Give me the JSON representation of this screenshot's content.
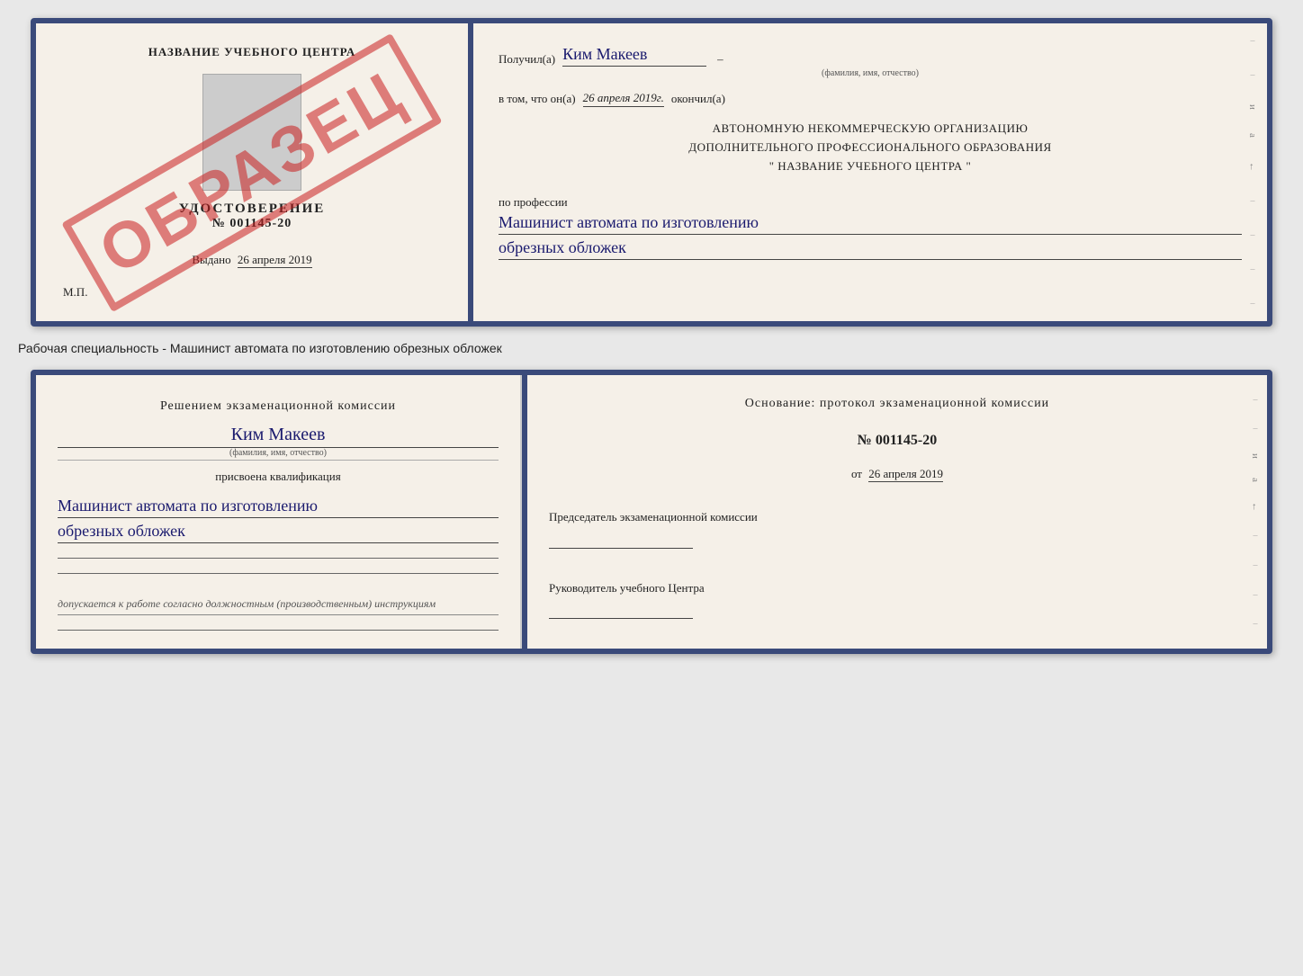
{
  "top_doc": {
    "left": {
      "title": "НАЗВАНИЕ УЧЕБНОГО ЦЕНТРА",
      "cert_word": "УДОСТОВЕРЕНИЕ",
      "cert_number": "№ 001145-20",
      "issued_label": "Выдано",
      "issued_date": "26 апреля 2019",
      "mp_label": "М.П.",
      "watermark": "ОБРАЗЕЦ"
    },
    "right": {
      "received_label": "Получил(а)",
      "received_name": "Ким Макеев",
      "received_dash": "–",
      "name_subtitle": "(фамилия, имя, отчество)",
      "date_prefix": "в том, что он(а)",
      "date_value": "26 апреля 2019г.",
      "date_suffix": "окончил(а)",
      "org_line1": "АВТОНОМНУЮ НЕКОММЕРЧЕСКУЮ ОРГАНИЗАЦИЮ",
      "org_line2": "ДОПОЛНИТЕЛЬНОГО ПРОФЕССИОНАЛЬНОГО ОБРАЗОВАНИЯ",
      "org_line3": "\"  НАЗВАНИЕ УЧЕБНОГО ЦЕНТРА  \"",
      "profession_label": "по профессии",
      "profession_line1": "Машинист автомата по изготовлению",
      "profession_line2": "обрезных обложек"
    }
  },
  "caption": "Рабочая специальность - Машинист автомата по изготовлению обрезных обложек",
  "bottom_doc": {
    "left": {
      "commission_title": "Решением экзаменационной  комиссии",
      "name": "Ким Макеев",
      "name_subtitle": "(фамилия, имя, отчество)",
      "assigned_label": "присвоена квалификация",
      "qualification_line1": "Машинист автомата по изготовлению",
      "qualification_line2": "обрезных обложек",
      "admission_text": "допускается к  работе согласно должностным (производственным) инструкциям"
    },
    "right": {
      "basis_label": "Основание: протокол экзаменационной  комиссии",
      "protocol_number": "№  001145-20",
      "protocol_date_prefix": "от",
      "protocol_date": "26 апреля 2019",
      "chairman_title": "Председатель экзаменационной комиссии",
      "director_title": "Руководитель учебного Центра"
    }
  }
}
